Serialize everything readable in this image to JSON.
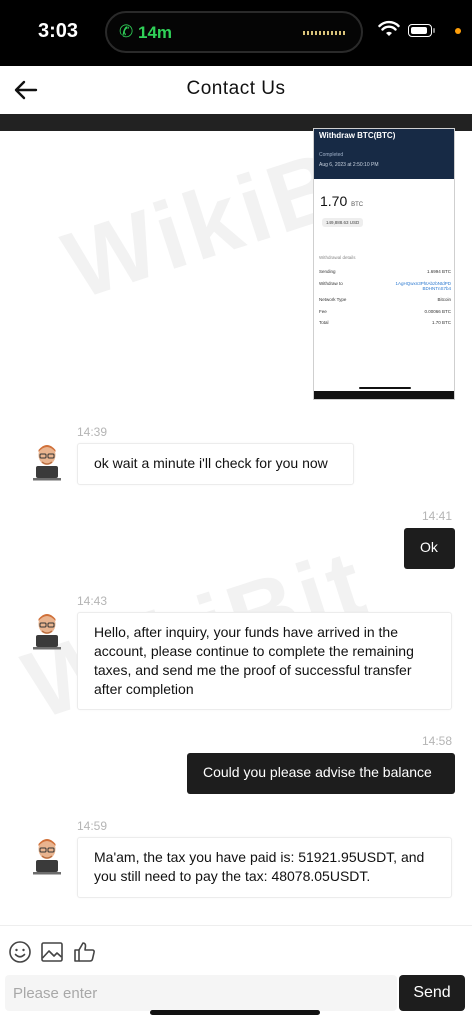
{
  "status_bar": {
    "time": "3:03",
    "call_duration": "14m"
  },
  "header": {
    "title": "Contact Us"
  },
  "watermark": {
    "text": "WikiBit"
  },
  "image_message": {
    "title": "Withdraw BTC(BTC)",
    "status": "Completed",
    "date": "Aug 6, 2023 at 2:50:10 PM",
    "amount": "1.70",
    "unit": "BTC",
    "usd": "149,888.63 USD",
    "section": "Withdrawal details",
    "rows": [
      {
        "label": "Sending",
        "value": "1.6994 BTC"
      },
      {
        "label": "Withdraw to",
        "value": "1AgHQwxn3PhtAbzbNtdPD BDHNTnS7b4"
      },
      {
        "label": "Network Type",
        "value": "Bitcoin"
      },
      {
        "label": "Fee",
        "value": "0.00066 BTC"
      },
      {
        "label": "Total",
        "value": "1.70 BTC"
      }
    ]
  },
  "messages": [
    {
      "time": "14:39",
      "text": "ok wait a minute i'll check for you now"
    },
    {
      "time": "14:41",
      "text": "Ok"
    },
    {
      "time": "14:43",
      "text": "Hello, after inquiry, your funds have arrived in the account, please continue to complete the remaining taxes, and send me the proof of successful transfer after completion"
    },
    {
      "time": "14:58",
      "text": "Could you please advise the balance"
    },
    {
      "time": "14:59",
      "text": "Ma'am, the tax you have paid is: 51921.95USDT, and you still need to pay the tax: 48078.05USDT."
    }
  ],
  "composer": {
    "placeholder": "Please enter",
    "send_label": "Send"
  },
  "colors": {
    "accent": "#1d1d1d",
    "call_green": "#30d158",
    "timestamp": "#b5b5b5"
  },
  "icons": [
    "phone-icon",
    "wifi-icon",
    "battery-icon",
    "back-arrow-icon",
    "avatar-icon",
    "emoji-icon",
    "image-icon",
    "thumbs-up-icon"
  ]
}
